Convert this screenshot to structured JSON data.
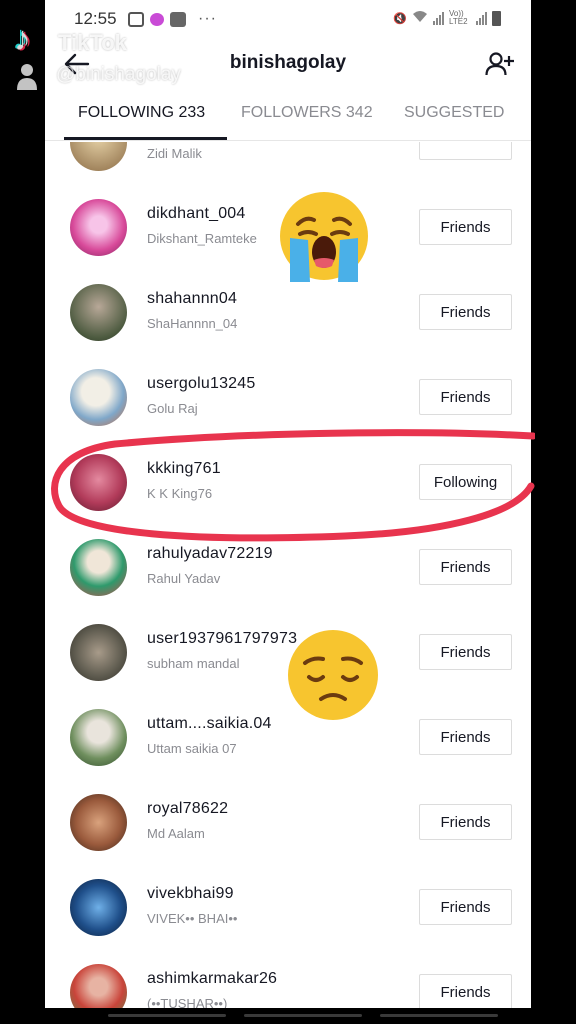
{
  "status_bar": {
    "time": "12:55",
    "dots": "···",
    "network": "Vo)) LTE2"
  },
  "header": {
    "title": "binishagolay"
  },
  "tabs": [
    {
      "label": "FOLLOWING 233",
      "active": true
    },
    {
      "label": "FOLLOWERS 342",
      "active": false
    },
    {
      "label": "SUGGESTED",
      "active": false
    }
  ],
  "watermark": {
    "brand": "TikTok",
    "handle": "@binishagolay"
  },
  "list": [
    {
      "username": "",
      "display_name": "Zidi Malik",
      "button": ""
    },
    {
      "username": "dikdhant_004",
      "display_name": "Dikshant_Ramteke",
      "button": "Friends"
    },
    {
      "username": "shahannn04",
      "display_name": "ShaHannnn_04",
      "button": "Friends"
    },
    {
      "username": "usergolu13245",
      "display_name": "Golu Raj",
      "button": "Friends"
    },
    {
      "username": "kkking761",
      "display_name": "K K King76",
      "button": "Following"
    },
    {
      "username": "rahulyadav72219",
      "display_name": "Rahul Yadav",
      "button": "Friends"
    },
    {
      "username": "user1937961797973",
      "display_name": "subham mandal",
      "button": "Friends"
    },
    {
      "username": "uttam....saikia.04",
      "display_name": "Uttam saikia 07",
      "button": "Friends"
    },
    {
      "username": "royal78622",
      "display_name": "Md Aalam",
      "button": "Friends"
    },
    {
      "username": "vivekbhai99",
      "display_name": "VIVEK•• BHAI••",
      "button": "Friends"
    },
    {
      "username": "ashimkarmakar26",
      "display_name": "(••TUSHAR••)",
      "button": "Friends"
    }
  ],
  "colors": {
    "text_primary": "#161823",
    "text_secondary": "#8a8b91",
    "highlight": "#e8344e",
    "emoji_yellow": "#f7c52f"
  },
  "icons": {
    "back": "arrow-left-icon",
    "add_user": "add-user-icon",
    "cry": "loudly-crying-face-emoji",
    "sad": "pensive-face-emoji"
  }
}
